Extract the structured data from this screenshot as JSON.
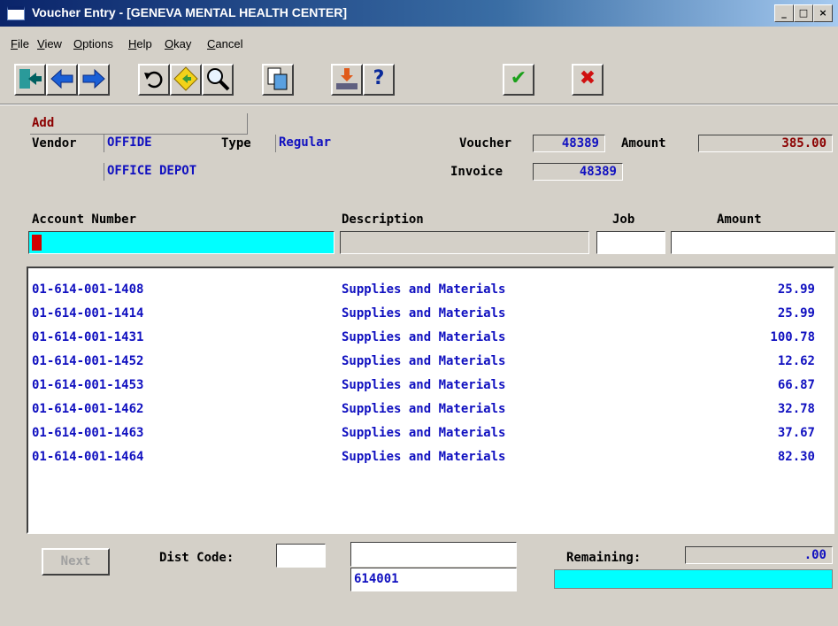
{
  "window": {
    "title": "Voucher Entry - [GENEVA MENTAL HEALTH CENTER]",
    "minimize": "_",
    "maximize": "□",
    "close": "×"
  },
  "menu": [
    "File",
    "View",
    "Options",
    "Help",
    "Okay",
    "Cancel"
  ],
  "toolbar": {
    "exit": "exit-icon",
    "prev": "arrow-left-icon",
    "next": "arrow-right-icon",
    "undo": "undo-icon",
    "find": "find-icon",
    "search": "magnifier-icon",
    "copy": "copy-icon",
    "import": "import-icon",
    "help": "?",
    "okay": "✔",
    "cancel": "✖"
  },
  "header": {
    "mode": "Add",
    "vendor_label": "Vendor",
    "vendor_code": "OFFIDE",
    "vendor_name": "OFFICE DEPOT",
    "type_label": "Type",
    "type_value": "Regular",
    "voucher_label": "Voucher",
    "voucher_value": "48389",
    "amount_label": "Amount",
    "amount_value": "385.00",
    "invoice_label": "Invoice",
    "invoice_value": "48389"
  },
  "columns": {
    "account": "Account Number",
    "description": "Description",
    "job": "Job",
    "amount": "Amount"
  },
  "entry": {
    "account": "",
    "description": "",
    "job": "",
    "amount": ""
  },
  "lines": [
    {
      "account": "01-614-001-1408",
      "description": "Supplies and Materials",
      "amount": "25.99"
    },
    {
      "account": "01-614-001-1414",
      "description": "Supplies and Materials",
      "amount": "25.99"
    },
    {
      "account": "01-614-001-1431",
      "description": "Supplies and Materials",
      "amount": "100.78"
    },
    {
      "account": "01-614-001-1452",
      "description": "Supplies and Materials",
      "amount": "12.62"
    },
    {
      "account": "01-614-001-1453",
      "description": "Supplies and Materials",
      "amount": "66.87"
    },
    {
      "account": "01-614-001-1462",
      "description": "Supplies and Materials",
      "amount": "32.78"
    },
    {
      "account": "01-614-001-1463",
      "description": "Supplies and Materials",
      "amount": "37.67"
    },
    {
      "account": "01-614-001-1464",
      "description": "Supplies and Materials",
      "amount": "82.30"
    }
  ],
  "footer": {
    "next_label": "Next",
    "dist_code_label": "Dist Code:",
    "dist_code_value": "",
    "code_top": "",
    "code_bottom": "614001",
    "remaining_label": "Remaining:",
    "remaining_value": ".00"
  },
  "colors": {
    "field_text": "#1010c0",
    "highlight": "#00ffff",
    "cursor": "#d00000",
    "mode_text": "#8b0000"
  }
}
